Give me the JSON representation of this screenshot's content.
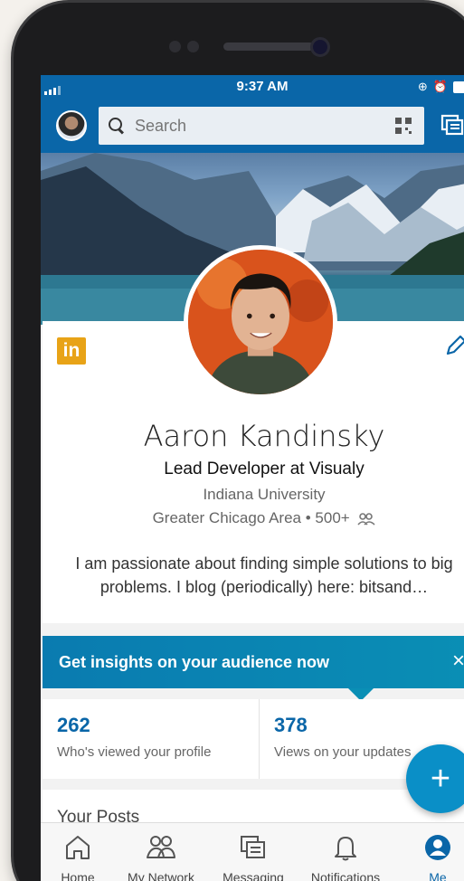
{
  "status_bar": {
    "time": "9:37 AM"
  },
  "header": {
    "search_placeholder": "Search"
  },
  "profile": {
    "badge": "in",
    "name": "Aaron Kandinsky",
    "headline": "Lead Developer at Visualy",
    "school": "Indiana University",
    "location": "Greater Chicago Area",
    "connections": "500+",
    "summary": "I am passionate about finding simple solutions to big problems. I blog (periodically) here: bitsand…"
  },
  "insights_banner": {
    "text": "Get insights on your audience now",
    "close": "×"
  },
  "stats": [
    {
      "value": "262",
      "label": "Who's viewed your profile"
    },
    {
      "value": "378",
      "label": "Views on your updates"
    }
  ],
  "posts": {
    "title": "Your Posts"
  },
  "fab": {
    "label": "+"
  },
  "bottom_nav": [
    {
      "label": "Home",
      "icon": "home-icon"
    },
    {
      "label": "My Network",
      "icon": "network-icon"
    },
    {
      "label": "Messaging",
      "icon": "messaging-icon"
    },
    {
      "label": "Notifications",
      "icon": "bell-icon"
    },
    {
      "label": "Me",
      "icon": "me-icon",
      "active": true
    }
  ],
  "colors": {
    "brand": "#0a66a8",
    "accent": "#0a8fc7",
    "badge": "#e8a317"
  }
}
